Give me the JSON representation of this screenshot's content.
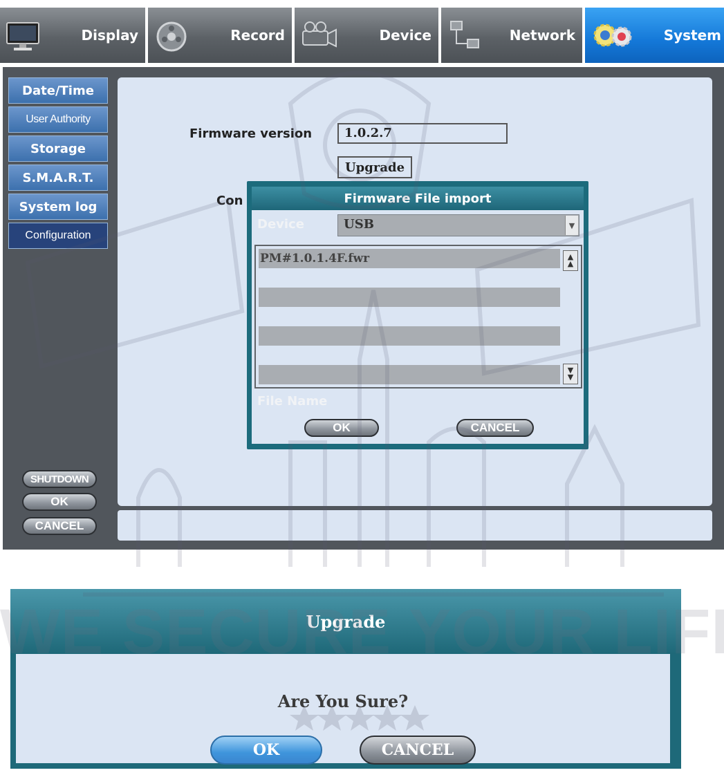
{
  "tabs": [
    {
      "label": "Display",
      "icon": "monitor-icon",
      "active": false
    },
    {
      "label": "Record",
      "icon": "film-reel-icon",
      "active": false
    },
    {
      "label": "Device",
      "icon": "camera-icon",
      "active": false
    },
    {
      "label": "Network",
      "icon": "network-icon",
      "active": false
    },
    {
      "label": "System",
      "icon": "gears-icon",
      "active": true
    }
  ],
  "sidebar": {
    "items": [
      {
        "label": "Date/Time"
      },
      {
        "label": "User Authority"
      },
      {
        "label": "Storage"
      },
      {
        "label": "S.M.A.R.T."
      },
      {
        "label": "System log"
      },
      {
        "label": "Configuration"
      }
    ],
    "shutdown": "SHUTDOWN",
    "ok": "OK",
    "cancel": "CANCEL"
  },
  "main": {
    "firmware_label": "Firmware version",
    "firmware_value": "1.0.2.7",
    "upgrade_button": "Upgrade",
    "config_label_partial": "Con"
  },
  "import_dialog": {
    "title": "Firmware File import",
    "device_label": "Device",
    "device_value": "USB",
    "files": [
      "PM#1.0.1.4F.fwr",
      "",
      "",
      "",
      "",
      ""
    ],
    "file_name_label": "File Name",
    "ok": "OK",
    "cancel": "CANCEL"
  },
  "confirm_dialog": {
    "title": "Upgrade",
    "message": "Are You Sure?",
    "ok": "OK",
    "cancel": "CANCEL"
  },
  "watermark": {
    "text": "WE SECURE YOUR LIFE"
  },
  "colors": {
    "active_tab": "#1478d8",
    "sidebar_button": "#4a7dbc",
    "sidebar_active": "#27437b",
    "dialog_teal": "#1e6878",
    "panel_bg": "#dbe5f3"
  }
}
